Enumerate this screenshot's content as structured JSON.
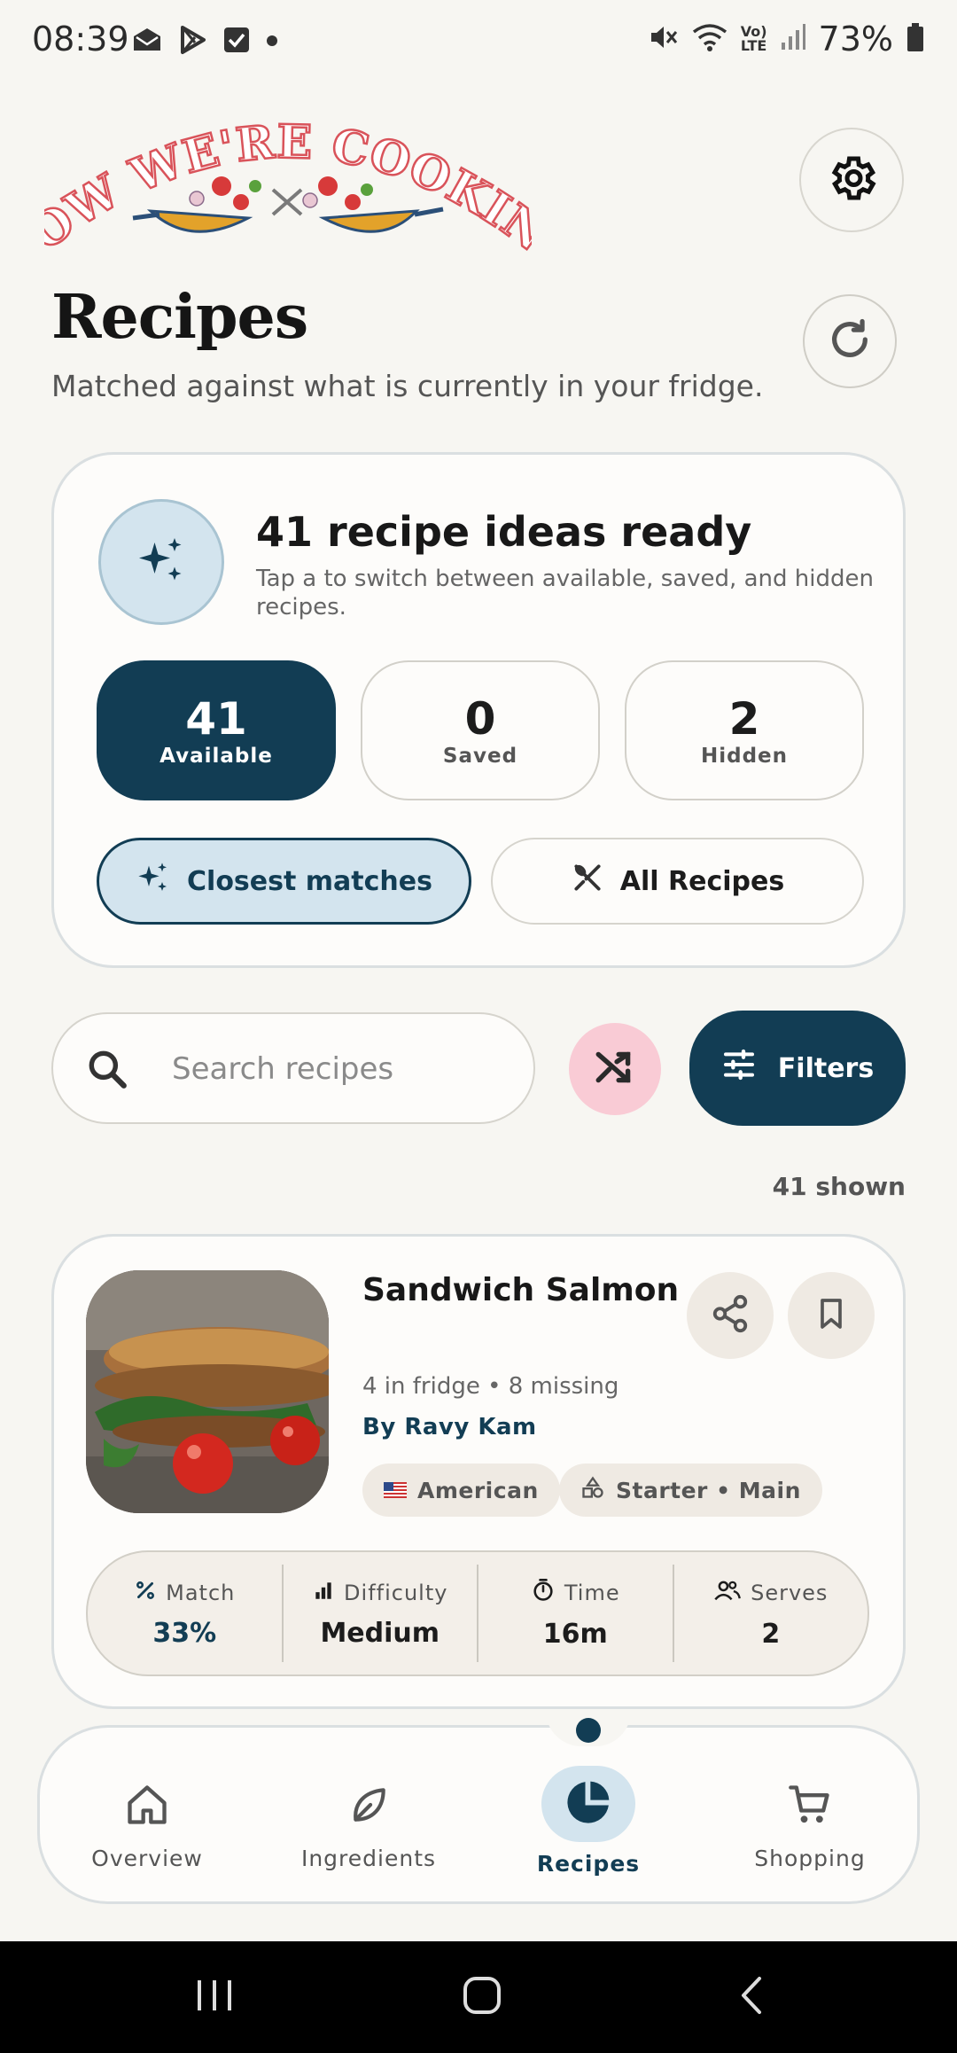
{
  "status_bar": {
    "time": "08:39",
    "battery": "73%",
    "left_icons": [
      "mail-icon",
      "play-store-icon",
      "checkbox-icon",
      "dot-icon"
    ],
    "right_icons": [
      "mute-icon",
      "wifi-icon",
      "volte-icon",
      "signal-icon",
      "battery-icon"
    ],
    "volte_top": "Vo)",
    "volte_bottom": "LTE"
  },
  "header": {
    "logo_text": "NOW WE'RE COOKING",
    "title": "Recipes",
    "subtitle": "Matched against what is currently in your fridge."
  },
  "summary": {
    "headline": "41 recipe ideas ready",
    "description": "Tap a to switch between available, saved, and hidden recipes.",
    "counts": [
      {
        "value": "41",
        "label": "Available",
        "active": true
      },
      {
        "value": "0",
        "label": "Saved",
        "active": false
      },
      {
        "value": "2",
        "label": "Hidden",
        "active": false
      }
    ],
    "modes": [
      {
        "label": "Closest matches",
        "icon": "sparkles-icon",
        "active": true
      },
      {
        "label": "All Recipes",
        "icon": "utensils-icon",
        "active": false
      }
    ]
  },
  "search": {
    "placeholder": "Search recipes",
    "value": "",
    "filters_label": "Filters"
  },
  "results": {
    "shown": "41 shown"
  },
  "recipes": [
    {
      "name": "Sandwich Salmon",
      "meta_fridge": "4 in fridge",
      "meta_missing": "8 missing",
      "author": "By Ravy Kam",
      "cuisine": "American",
      "course": "Starter • Main",
      "stats": [
        {
          "label": "Match",
          "value": "33%",
          "icon": "percent-icon"
        },
        {
          "label": "Difficulty",
          "value": "Medium",
          "icon": "bars-icon"
        },
        {
          "label": "Time",
          "value": "16m",
          "icon": "timer-icon"
        },
        {
          "label": "Serves",
          "value": "2",
          "icon": "people-icon"
        }
      ]
    }
  ],
  "nav": {
    "items": [
      {
        "label": "Overview",
        "icon": "home-icon",
        "active": false
      },
      {
        "label": "Ingredients",
        "icon": "leaf-icon",
        "active": false
      },
      {
        "label": "Recipes",
        "icon": "pie-icon",
        "active": true
      },
      {
        "label": "Shopping",
        "icon": "cart-icon",
        "active": false
      }
    ]
  },
  "colors": {
    "accent": "#123d54",
    "accent_light": "#d3e4ee",
    "shuffle_bg": "#f9cbd5",
    "background": "#f7f6f2"
  }
}
